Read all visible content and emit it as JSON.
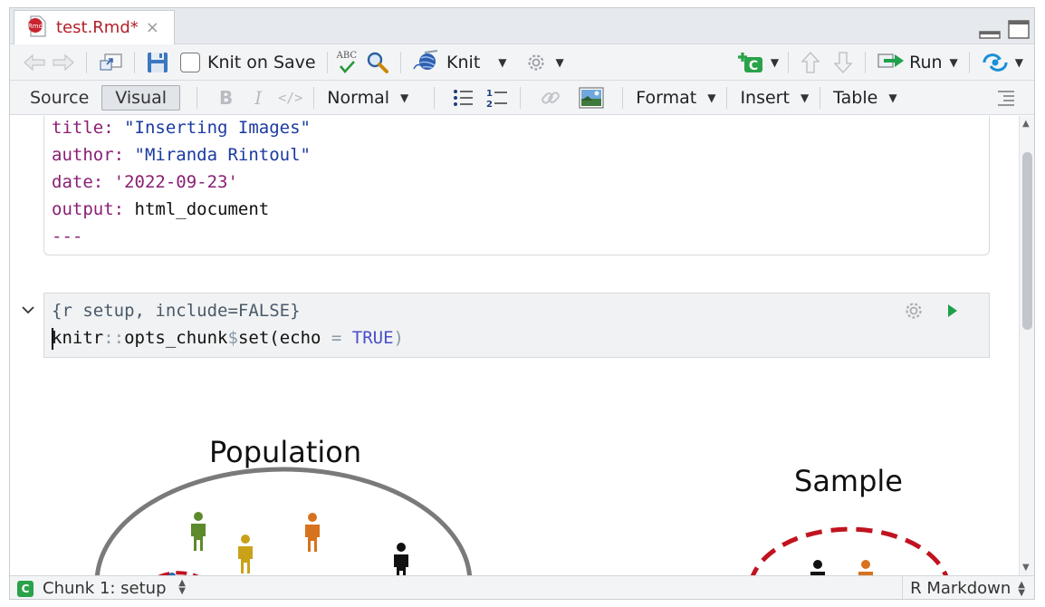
{
  "tab": {
    "title": "test.Rmd*",
    "close_symbol": "×",
    "file_icon": "rmd-file-icon"
  },
  "toolbar": {
    "knit_on_save_label": "Knit on Save",
    "knit_label": "Knit",
    "run_label": "Run",
    "abc_label": "ABC"
  },
  "format_bar": {
    "source_label": "Source",
    "visual_label": "Visual",
    "bold_label": "B",
    "italic_label": "I",
    "code_label": "</>",
    "paragraph_style": "Normal",
    "format_label": "Format",
    "insert_label": "Insert",
    "table_label": "Table"
  },
  "yaml": {
    "lines": [
      {
        "key": "title:",
        "value": "\"Inserting Images\""
      },
      {
        "key": "author:",
        "value": "\"Miranda Rintoul\""
      },
      {
        "key": "date:",
        "value": "'2022-09-23'"
      },
      {
        "key": "output:",
        "value": "html_document"
      }
    ],
    "end_marker": "---"
  },
  "chunk": {
    "header": "{r setup, include=FALSE}",
    "code_obj": "knitr",
    "code_op": "::",
    "code_fn": "opts_chunk",
    "code_dollar": "$",
    "code_set": "set(echo ",
    "code_eq": "=",
    "code_true": " TRUE",
    "code_close": ")"
  },
  "figure": {
    "population_label": "Population",
    "sample_label": "Sample"
  },
  "statusbar": {
    "chunk_label": "Chunk 1: setup",
    "language": "R Markdown",
    "badge": "C"
  },
  "colors": {
    "tab_title": "#b3202a",
    "yaml_key": "#8a1f74",
    "yaml_string": "#1a3aa0",
    "keyword_true": "#4a4ec8",
    "run_green": "#1ea14a",
    "dashed_red": "#c0131f"
  }
}
